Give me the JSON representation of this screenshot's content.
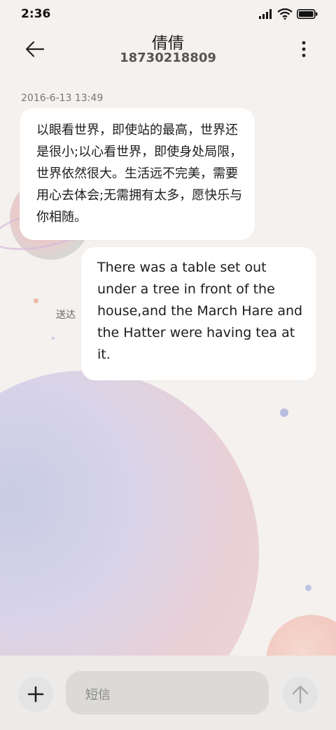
{
  "status_bar": {
    "time": "2:36"
  },
  "header": {
    "name": "倩倩",
    "number": "18730218809"
  },
  "messages": {
    "timestamp": "2016-6-13 13:49",
    "incoming_text": "以眼看世界，即使站的最高，世界还是很小;以心看世界，即使身处局限，世界依然很大。生活远不完美，需要用心去体会;无需拥有太多，愿快乐与你相随。",
    "outgoing_text": "There was a table set out under a tree in front of the house,and the March Hare and the Hatter were having tea at it.",
    "outgoing_status": "送达"
  },
  "composer": {
    "placeholder": "短信"
  },
  "icons": {
    "back": "arrow-left-icon",
    "more": "more-vertical-icon",
    "add": "plus-icon",
    "send": "arrow-up-icon"
  },
  "colors": {
    "background": "#f4f1ef",
    "bubble": "#ffffff",
    "bottom_bar": "#ecebea"
  }
}
